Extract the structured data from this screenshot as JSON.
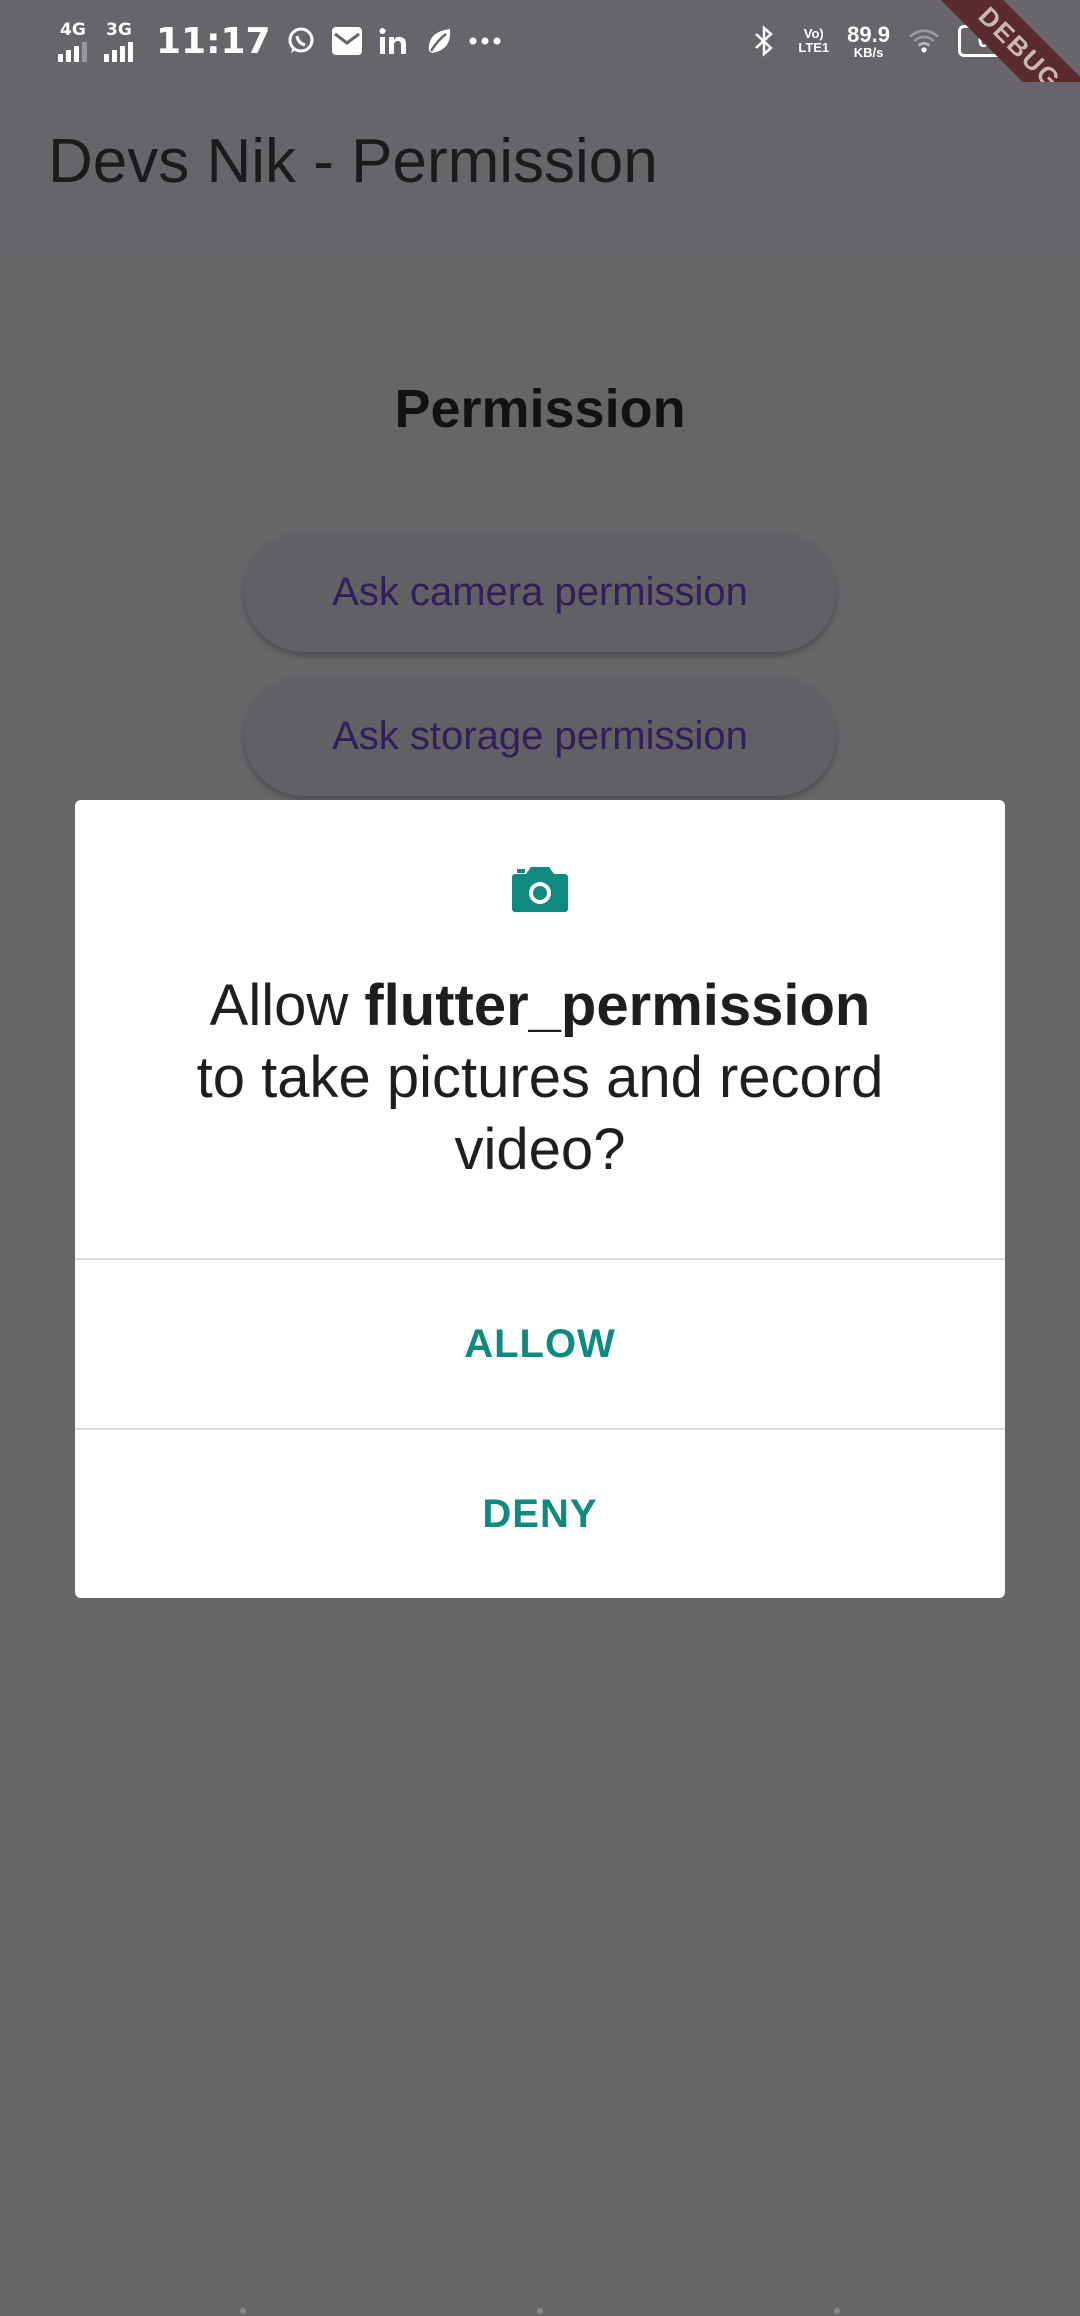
{
  "status_bar": {
    "network_1": "4G",
    "network_2": "3G",
    "time": "11:17",
    "volte_line1": "Vo)",
    "volte_line2": "LTE1",
    "speed_value": "89.9",
    "speed_unit": "KB/s",
    "battery": "60",
    "notification_icons": [
      "whatsapp-icon",
      "mail-icon",
      "linkedin-icon",
      "leaf-icon",
      "more-dots-icon"
    ],
    "system_icons": [
      "bluetooth-icon",
      "wifi-icon",
      "battery-icon"
    ]
  },
  "debug_banner": "DEBUG",
  "app_bar": {
    "title": "Devs Nik - Permission"
  },
  "main": {
    "heading": "Permission",
    "camera_button": "Ask camera permission",
    "storage_button": "Ask storage permission"
  },
  "dialog": {
    "icon": "camera-icon",
    "message_prefix": "Allow ",
    "app_name": "flutter_permission",
    "message_suffix": "to take pictures and record video?",
    "allow_label": "ALLOW",
    "deny_label": "DENY"
  },
  "colors": {
    "scrim": "#686569",
    "dialog_accent": "#0f8a7e",
    "button_text": "#2e2158"
  }
}
